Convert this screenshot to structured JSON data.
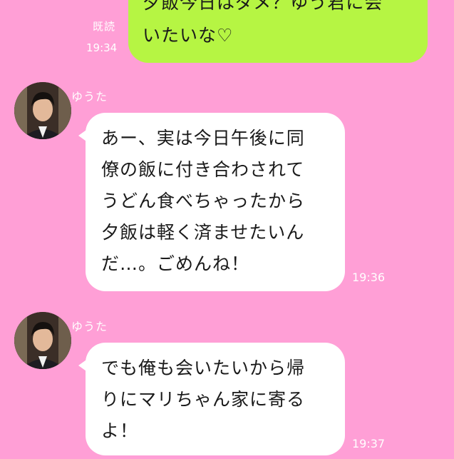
{
  "outgoing": {
    "lines": [
      "夕飯今日はダメ？ゆう君に会",
      "いたいな♡"
    ],
    "read_label": "既読",
    "time": "19:34"
  },
  "messages": [
    {
      "sender": "ゆうた",
      "lines": [
        "あー、実は今日午後に同",
        "僚の飯に付き合わされて",
        "うどん食べちゃったから",
        "夕飯は軽く済ませたいん",
        "だ…。ごめんね！"
      ],
      "time": "19:36"
    },
    {
      "sender": "ゆうた",
      "lines": [
        "でも俺も会いたいから帰",
        "りにマリちゃん家に寄る",
        "よ！"
      ],
      "time": "19:37"
    }
  ],
  "colors": {
    "background": "#FF9FD6",
    "outgoing_bubble": "#B6F543",
    "incoming_bubble": "#FFFFFF"
  }
}
